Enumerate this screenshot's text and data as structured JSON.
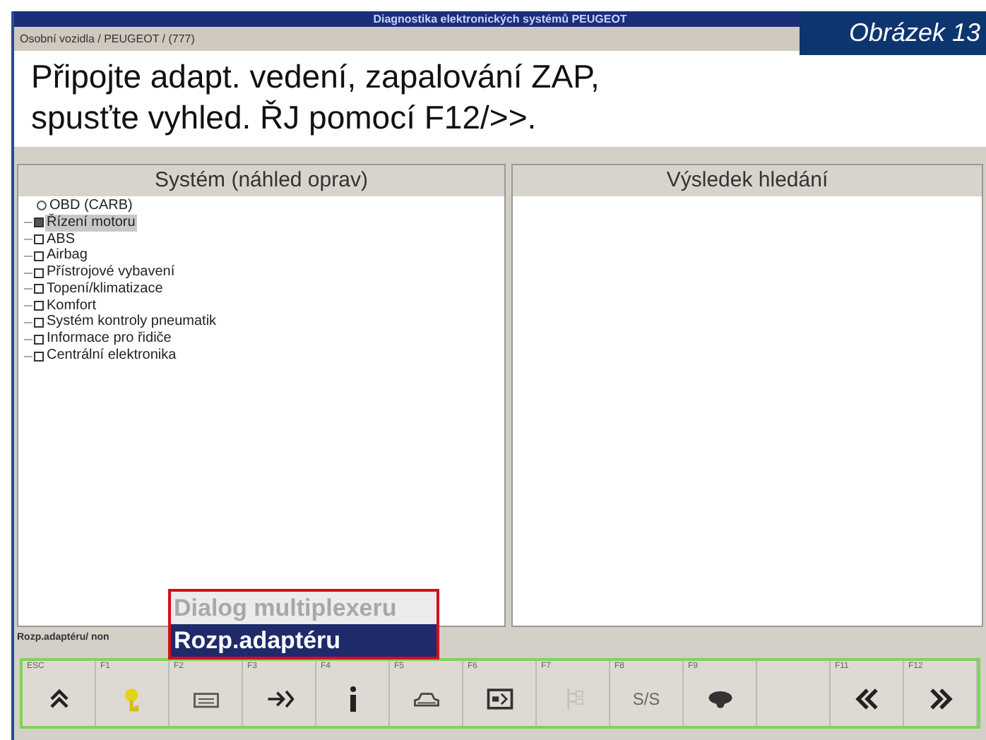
{
  "window": {
    "title": "Diagnostika elektronických systémů PEUGEOT"
  },
  "breadcrumb": "Osobní vozidla / PEUGEOT / (777)",
  "figure_label": "Obrázek 13",
  "instruction": "Připojte adapt. vedení, zapalování ZAP, spusťte vyhled. ŘJ pomocí F12/>>.",
  "left_panel": {
    "title": "Systém (náhled oprav)",
    "items": [
      {
        "label": "OBD (CARB)",
        "kind": "circle",
        "selected": false
      },
      {
        "label": "Řízení motoru",
        "kind": "box",
        "selected": true
      },
      {
        "label": "ABS",
        "kind": "box",
        "selected": false
      },
      {
        "label": "Airbag",
        "kind": "box",
        "selected": false
      },
      {
        "label": "Přístrojové vybavení",
        "kind": "box",
        "selected": false
      },
      {
        "label": "Topení/klimatizace",
        "kind": "box",
        "selected": false
      },
      {
        "label": "Komfort",
        "kind": "box",
        "selected": false
      },
      {
        "label": "Systém kontroly pneumatik",
        "kind": "box",
        "selected": false
      },
      {
        "label": "Informace pro řidiče",
        "kind": "box",
        "selected": false
      },
      {
        "label": "Centrální elektronika",
        "kind": "box",
        "selected": false
      }
    ]
  },
  "right_panel": {
    "title": "Výsledek hledání"
  },
  "status_line": "Rozp.adaptéru/ non",
  "popup_menu": [
    {
      "label": "Dialog multiplexeru",
      "disabled": true,
      "selected": false
    },
    {
      "label": "Rozp.adaptéru",
      "disabled": false,
      "selected": true
    }
  ],
  "function_keys": [
    {
      "key": "ESC",
      "kind": "up",
      "disabled": false
    },
    {
      "key": "F1",
      "kind": "key",
      "disabled": false
    },
    {
      "key": "F2",
      "kind": "device",
      "disabled": false
    },
    {
      "key": "F3",
      "kind": "enter",
      "disabled": false
    },
    {
      "key": "F4",
      "kind": "info",
      "disabled": false
    },
    {
      "key": "F5",
      "kind": "vehicle",
      "disabled": false
    },
    {
      "key": "F6",
      "kind": "screen",
      "disabled": false
    },
    {
      "key": "F7",
      "kind": "tree",
      "disabled": true
    },
    {
      "key": "F8",
      "kind": "text",
      "text": "S/S",
      "disabled": true
    },
    {
      "key": "F9",
      "kind": "wheel",
      "disabled": false
    },
    {
      "kind": "blank"
    },
    {
      "key": "F11",
      "kind": "back",
      "disabled": false
    },
    {
      "key": "F12",
      "kind": "forward",
      "disabled": false
    }
  ]
}
